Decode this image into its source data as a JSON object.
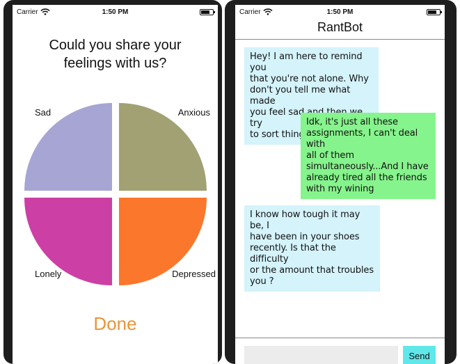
{
  "left_screen": {
    "status_bar": {
      "carrier": "Carrier",
      "time": "1:50 PM"
    },
    "question": [
      "Could you share your",
      "feelings with us?"
    ],
    "chart_data": {
      "type": "pie",
      "slices": [
        {
          "label": "Sad",
          "value": 25,
          "color": "#a6a5d3"
        },
        {
          "label": "Anxious",
          "value": 25,
          "color": "#a2a174"
        },
        {
          "label": "Lonely",
          "value": 25,
          "color": "#cc3fa4"
        },
        {
          "label": "Depressed",
          "value": 25,
          "color": "#fb772c"
        }
      ]
    },
    "done_label": "Done",
    "done_color": "#e8953a"
  },
  "right_screen": {
    "status_bar": {
      "carrier": "Carrier",
      "time": "1:50 PM"
    },
    "title": "RantBot",
    "messages": [
      {
        "sender": "bot",
        "lines": [
          "Hey! I am here to remind you",
          "that you're not alone. Why",
          "don't you tell me what made",
          "you feel sad and then we try",
          "to sort things out together?"
        ]
      },
      {
        "sender": "user",
        "lines": [
          "Idk, it's just all these",
          "assignments, I can't deal with",
          "all of them",
          "simultaneously...And I have",
          "already tired all the friends",
          "with my wining"
        ]
      },
      {
        "sender": "bot",
        "lines": [
          "I know how tough it may be, I",
          "have been in your shoes",
          "recently. Is that the difficulty",
          "or the amount that troubles",
          "you ?"
        ]
      }
    ],
    "input": {
      "value": "",
      "placeholder": ""
    },
    "send_label": "Send",
    "colors": {
      "bot_bubble": "#d4f3fb",
      "user_bubble": "#86f48c",
      "send_button": "#5fe7e9"
    }
  }
}
